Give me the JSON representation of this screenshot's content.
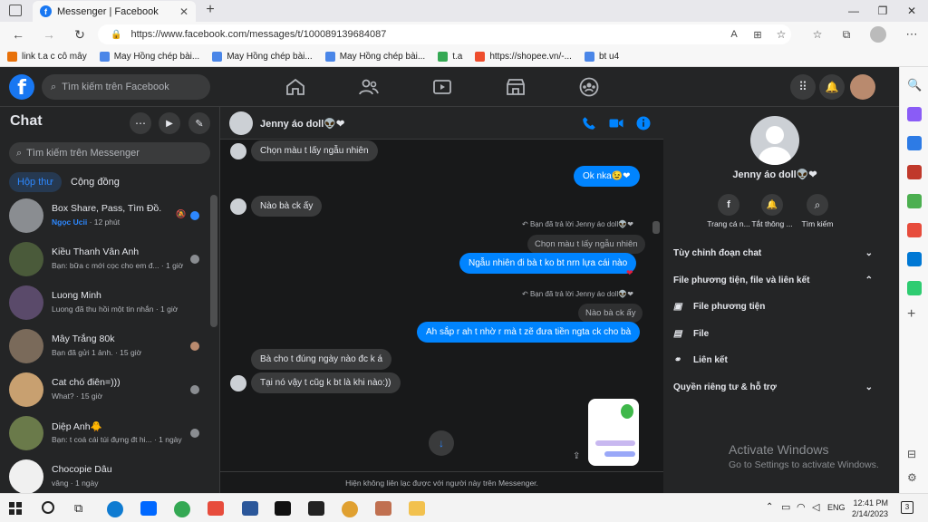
{
  "browser": {
    "tab_title": "Messenger | Facebook",
    "url": "https://www.facebook.com/messages/t/100089139684087",
    "bookmarks": [
      {
        "label": "link t.a c cô mây",
        "color": "#e8710a"
      },
      {
        "label": "May Hồng chép bài...",
        "color": "#4a86e8"
      },
      {
        "label": "May Hồng chép bài...",
        "color": "#4a86e8"
      },
      {
        "label": "May Hồng chép bài...",
        "color": "#4a86e8"
      },
      {
        "label": "t.a",
        "color": "#34a853"
      },
      {
        "label": "https://shopee.vn/-...",
        "color": "#ee4d2d"
      },
      {
        "label": "bt u4",
        "color": "#4a86e8"
      }
    ]
  },
  "fb": {
    "search_placeholder": "Tìm kiếm trên Facebook"
  },
  "chat": {
    "title": "Chat",
    "search_placeholder": "Tìm kiếm trên Messenger",
    "tab_inbox": "Hộp thư",
    "tab_community": "Cộng đồng",
    "conversations": [
      {
        "name": "Box Share, Pass, Tìm Đồ.",
        "sender": "Ngọc Ucii",
        "preview": " · 12 phút",
        "avatar": "#8a8d91",
        "status": "unread"
      },
      {
        "name": "Kiều Thanh Vân Anh",
        "preview": "Bạn: bữa c mới cọc cho em đ... · 1 giờ",
        "avatar": "#4a5a3a",
        "status": "seen"
      },
      {
        "name": "Luong Minh",
        "preview": "Luong đã thu hồi một tin nhắn · 1 giờ",
        "avatar": "#5a4a6a",
        "status": "none"
      },
      {
        "name": "Mây Trắng 80k",
        "preview": "Bạn đã gửi 1 ảnh. · 15 giờ",
        "avatar": "#7a6a5a",
        "status": "avatar"
      },
      {
        "name": "Cat chó điên=)))",
        "preview": "What? · 15 giờ",
        "avatar": "#c8a070",
        "status": "seen"
      },
      {
        "name": "Diệp Anh🐥",
        "preview": "Bạn: t coá cái túi đựng đt hi... · 1 ngày",
        "avatar": "#6a7a4a",
        "status": "seen"
      },
      {
        "name": "Chocopie Dâu",
        "preview": "vâng · 1 ngày",
        "avatar": "#f0f0f0",
        "status": "none"
      }
    ]
  },
  "conversation": {
    "name": "Jenny áo doll👽❤",
    "messages": {
      "m1": "Chọn màu t lấy ngẫu nhiên",
      "m2": "Ok nka😉❤",
      "m3": "Nào bà ck ấy",
      "r1_label": "Bạn đã trả lời Jenny áo doll👽❤",
      "r1_quote": "Chọn màu t lấy ngẫu nhiên",
      "m4": "Ngẫu nhiên đi bà t ko bt nrn lựa cái nào",
      "r2_label": "Bạn đã trả lời Jenny áo doll👽❤",
      "r2_quote": "Nào bà ck ấy",
      "m5": "Ah sắp r ah t nhờ r mà t zẽ đưa tiền ngta ck cho bà",
      "m6": "Bà cho t đúng ngày nào đc k á",
      "m7": "Tại nó vậy t cũg k bt là khi nào:))",
      "heart": "❤"
    },
    "footer": "Hiện không liên lạc được với người này trên Messenger."
  },
  "info": {
    "name": "Jenny áo doll👽❤",
    "actions": [
      "Trang cá n...",
      "Tắt thông ...",
      "Tìm kiếm"
    ],
    "customize": "Tùy chỉnh đoạn chat",
    "media_section": "File phương tiện, file và liên kết",
    "media": "File phương tiện",
    "files": "File",
    "links": "Liên kết",
    "privacy": "Quyền riêng tư & hỗ trợ"
  },
  "watermark": {
    "title": "Activate Windows",
    "sub": "Go to Settings to activate Windows."
  },
  "taskbar": {
    "lang": "ENG",
    "time": "12:41 PM",
    "date": "2/14/2023",
    "notif": "3"
  }
}
